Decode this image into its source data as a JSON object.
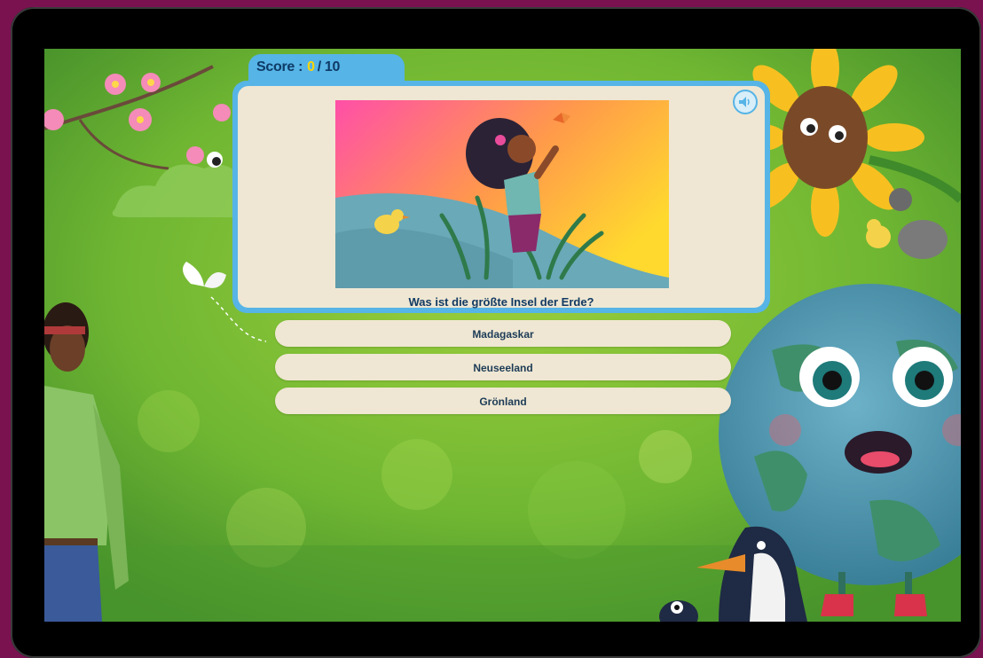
{
  "score": {
    "label": "Score :",
    "current": "0",
    "separator": "/",
    "total": "10"
  },
  "question": {
    "text": "Was ist die größte Insel der Erde?",
    "sound_icon": "speaker-icon",
    "image": "girl-with-butterfly-illustration"
  },
  "answers": [
    {
      "label": "Madagaskar"
    },
    {
      "label": "Neuseeland"
    },
    {
      "label": "Grönland"
    }
  ],
  "colors": {
    "frame": "#7a1250",
    "card_border": "#56b4e6",
    "card_bg": "#efe7d3",
    "score_value": "#ffd600",
    "text_dark": "#123a63"
  }
}
